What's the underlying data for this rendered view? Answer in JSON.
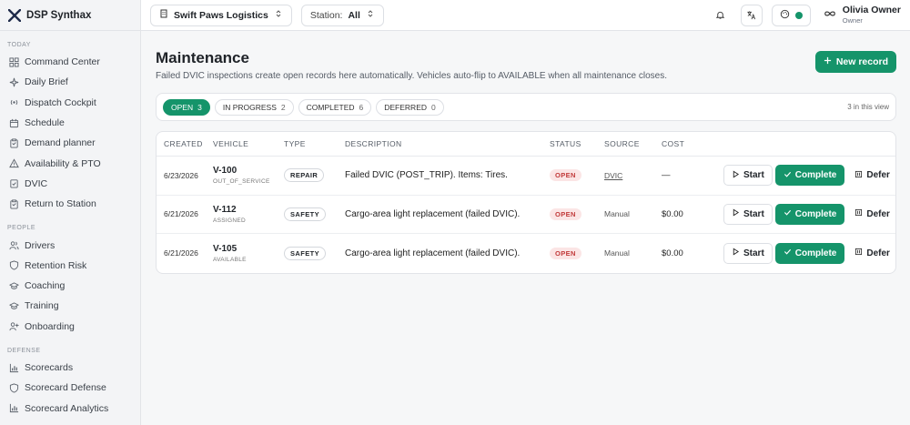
{
  "brand": {
    "name": "DSP Synthax",
    "logo_icon": "brand-logo-icon"
  },
  "sidebar": {
    "sections": [
      {
        "label": "TODAY",
        "items": [
          {
            "label": "Command Center",
            "icon": "grid-icon"
          },
          {
            "label": "Daily Brief",
            "icon": "sparkle-icon"
          },
          {
            "label": "Dispatch Cockpit",
            "icon": "radio-icon"
          },
          {
            "label": "Schedule",
            "icon": "calendar-icon"
          },
          {
            "label": "Demand planner",
            "icon": "clipboard-icon"
          },
          {
            "label": "Availability & PTO",
            "icon": "warning-icon"
          },
          {
            "label": "DVIC",
            "icon": "check-clipboard-icon"
          },
          {
            "label": "Return to Station",
            "icon": "clipboard-icon"
          }
        ]
      },
      {
        "label": "PEOPLE",
        "items": [
          {
            "label": "Drivers",
            "icon": "users-icon"
          },
          {
            "label": "Retention Risk",
            "icon": "shield-icon"
          },
          {
            "label": "Coaching",
            "icon": "graduation-icon"
          },
          {
            "label": "Training",
            "icon": "graduation-icon"
          },
          {
            "label": "Onboarding",
            "icon": "user-plus-icon"
          }
        ]
      },
      {
        "label": "DEFENSE",
        "items": [
          {
            "label": "Scorecards",
            "icon": "bar-chart-icon"
          },
          {
            "label": "Scorecard Defense",
            "icon": "shield-icon"
          },
          {
            "label": "Scorecard Analytics",
            "icon": "bar-chart-icon"
          }
        ]
      }
    ]
  },
  "topbar": {
    "company": "Swift Paws Logistics",
    "station_label": "Station:",
    "station_value": "All",
    "status_color": "#15946a",
    "user": {
      "name": "Olivia Owner",
      "role": "Owner"
    }
  },
  "page": {
    "title": "Maintenance",
    "subtitle": "Failed DVIC inspections create open records here automatically. Vehicles auto-flip to AVAILABLE when all maintenance closes.",
    "new_record_label": "New record"
  },
  "tabs": [
    {
      "label": "OPEN",
      "count": "3",
      "active": true
    },
    {
      "label": "IN PROGRESS",
      "count": "2",
      "active": false
    },
    {
      "label": "COMPLETED",
      "count": "6",
      "active": false
    },
    {
      "label": "DEFERRED",
      "count": "0",
      "active": false
    }
  ],
  "view_count": "3 in this view",
  "table": {
    "headers": {
      "created": "CREATED",
      "vehicle": "VEHICLE",
      "type": "TYPE",
      "description": "DESCRIPTION",
      "status": "STATUS",
      "source": "SOURCE",
      "cost": "COST"
    },
    "actions": {
      "start": "Start",
      "complete": "Complete",
      "defer": "Defer"
    },
    "rows": [
      {
        "created": "6/23/2026",
        "vehicle_id": "V-100",
        "vehicle_status": "OUT_OF_SERVICE",
        "type": "REPAIR",
        "description": "Failed DVIC (POST_TRIP). Items: Tires.",
        "status": "OPEN",
        "source": "DVIC",
        "cost": "—"
      },
      {
        "created": "6/21/2026",
        "vehicle_id": "V-112",
        "vehicle_status": "ASSIGNED",
        "type": "SAFETY",
        "description": "Cargo-area light replacement (failed DVIC).",
        "status": "OPEN",
        "source": "Manual",
        "cost": "$0.00"
      },
      {
        "created": "6/21/2026",
        "vehicle_id": "V-105",
        "vehicle_status": "AVAILABLE",
        "type": "SAFETY",
        "description": "Cargo-area light replacement (failed DVIC).",
        "status": "OPEN",
        "source": "Manual",
        "cost": "$0.00"
      }
    ]
  },
  "colors": {
    "accent": "#15946a",
    "status_open_bg": "#fbe5e5",
    "status_open_text": "#c23a3a"
  }
}
